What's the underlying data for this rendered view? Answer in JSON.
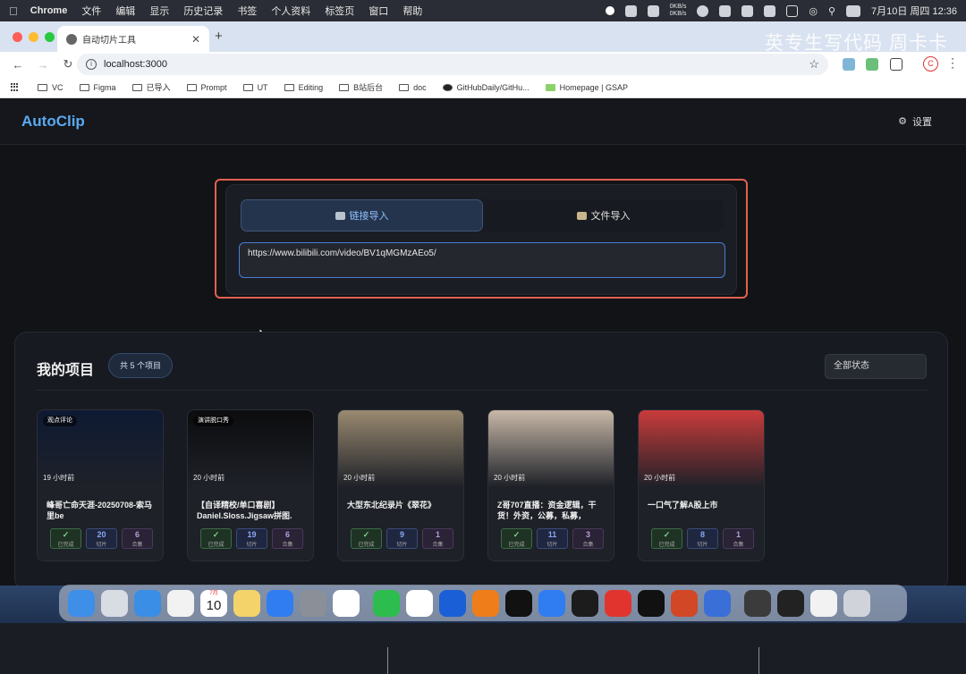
{
  "menubar": {
    "app": "Chrome",
    "items": [
      "文件",
      "编辑",
      "显示",
      "历史记录",
      "书签",
      "个人资料",
      "标签页",
      "窗口",
      "帮助"
    ],
    "net_up": "0KB/s",
    "net_down": "0KB/s",
    "datetime": "7月10日 周四  12:36"
  },
  "browser": {
    "tab_title": "自动切片工具",
    "url": "localhost:3000",
    "watermark": "英专生写代码 周卡卡",
    "avatar_letter": "C",
    "bookmarks": [
      "VC",
      "Figma",
      "已导入",
      "Prompt",
      "UT",
      "Editing",
      "B站后台",
      "doc",
      "GitHubDaily/GitHu...",
      "Homepage | GSAP"
    ]
  },
  "app": {
    "logo": "AutoClip",
    "settings_label": "设置",
    "import": {
      "tab_link": "链接导入",
      "tab_file": "文件导入",
      "url_value": "https://www.bilibili.com/video/BV1qMGMzAEo5/"
    },
    "projects": {
      "title": "我的项目",
      "count_label": "共 5 个项目",
      "filter_value": "全部状态",
      "cards": [
        {
          "tag": "观点评论",
          "time": "19 小时前",
          "title": "峰哥亡命天涯-20250708-索马里be",
          "status": "已完成",
          "clips": "20",
          "clips_label": "切片",
          "collections": "6",
          "collections_label": "合集",
          "thumb": "#0e1a33"
        },
        {
          "tag": "演讲脱口秀",
          "time": "20 小时前",
          "title": "【自译精校/单口喜剧】Daniel.Sloss.Jigsaw拼图.",
          "status": "已完成",
          "clips": "19",
          "clips_label": "切片",
          "collections": "6",
          "collections_label": "合集",
          "thumb": "#0c0c0e"
        },
        {
          "tag": "",
          "time": "20 小时前",
          "title": "大型东北纪录片《翠花》",
          "status": "已完成",
          "clips": "9",
          "clips_label": "切片",
          "collections": "1",
          "collections_label": "合集",
          "thumb": "#9a8a70"
        },
        {
          "tag": "",
          "time": "20 小时前",
          "title": "Z哥707直播：资金逻辑，干货！外资，公募，私募，",
          "status": "已完成",
          "clips": "11",
          "clips_label": "切片",
          "collections": "3",
          "collections_label": "合集",
          "thumb": "#c8b8a8"
        },
        {
          "tag": "",
          "time": "20 小时前",
          "title": "一口气了解A股上市",
          "status": "已完成",
          "clips": "8",
          "clips_label": "切片",
          "collections": "1",
          "collections_label": "合集",
          "thumb": "#c93b3b"
        }
      ]
    }
  },
  "dock": {
    "icons": [
      "finder-icon",
      "launchpad-icon",
      "safari-icon",
      "photos-icon",
      "calendar-icon",
      "notes-icon",
      "app-store-icon",
      "system-settings-icon",
      "chrome-icon",
      "wechat-icon",
      "chatgpt-icon",
      "mail-icon",
      "sublime-icon",
      "cursor-icon",
      "quickq-icon",
      "terminal-icon",
      "netease-music-icon",
      "qq-icon",
      "powerpoint-icon",
      "quicktime-icon",
      "screenshot-stack-icon",
      "downloads-stack-icon",
      "documents-stack-icon",
      "trash-icon"
    ],
    "calendar_day": "10",
    "calendar_month": "7月"
  }
}
